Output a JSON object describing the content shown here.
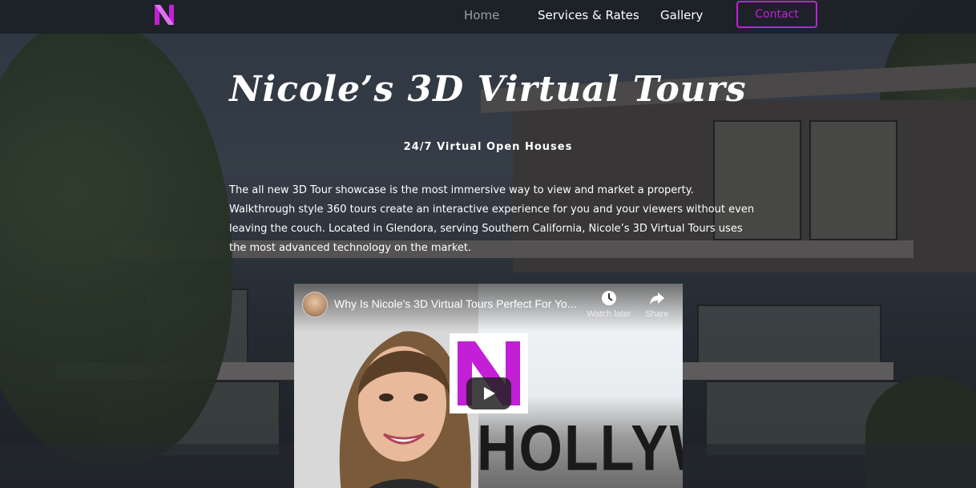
{
  "nav": {
    "links": [
      "Home",
      "Services & Rates",
      "Gallery"
    ],
    "contact_label": "Contact"
  },
  "hero": {
    "title": "Nicole’s 3D Virtual Tours",
    "subtitle": "24/7 Virtual Open Houses",
    "description": "The all new 3D Tour showcase is the most immersive way to view and market a property. Walkthrough style 360 tours create an interactive experience for you and your viewers without even leaving the couch. Located in Glendora, serving Southern California, Nicole’s 3D Virtual Tours uses the most advanced technology on the market."
  },
  "video": {
    "title": "Why Is Nicole's 3D Virtual Tours Perfect For Yo...",
    "watch_later": "Watch later",
    "share": "Share",
    "background_text": "HOLLYWO"
  },
  "colors": {
    "accent": "#c21fd6",
    "nav_bg": "#1c2126",
    "home_link": "#9aa0a6"
  },
  "icons": [
    "brand-logo-icon",
    "clock-icon",
    "share-icon",
    "play-icon"
  ]
}
